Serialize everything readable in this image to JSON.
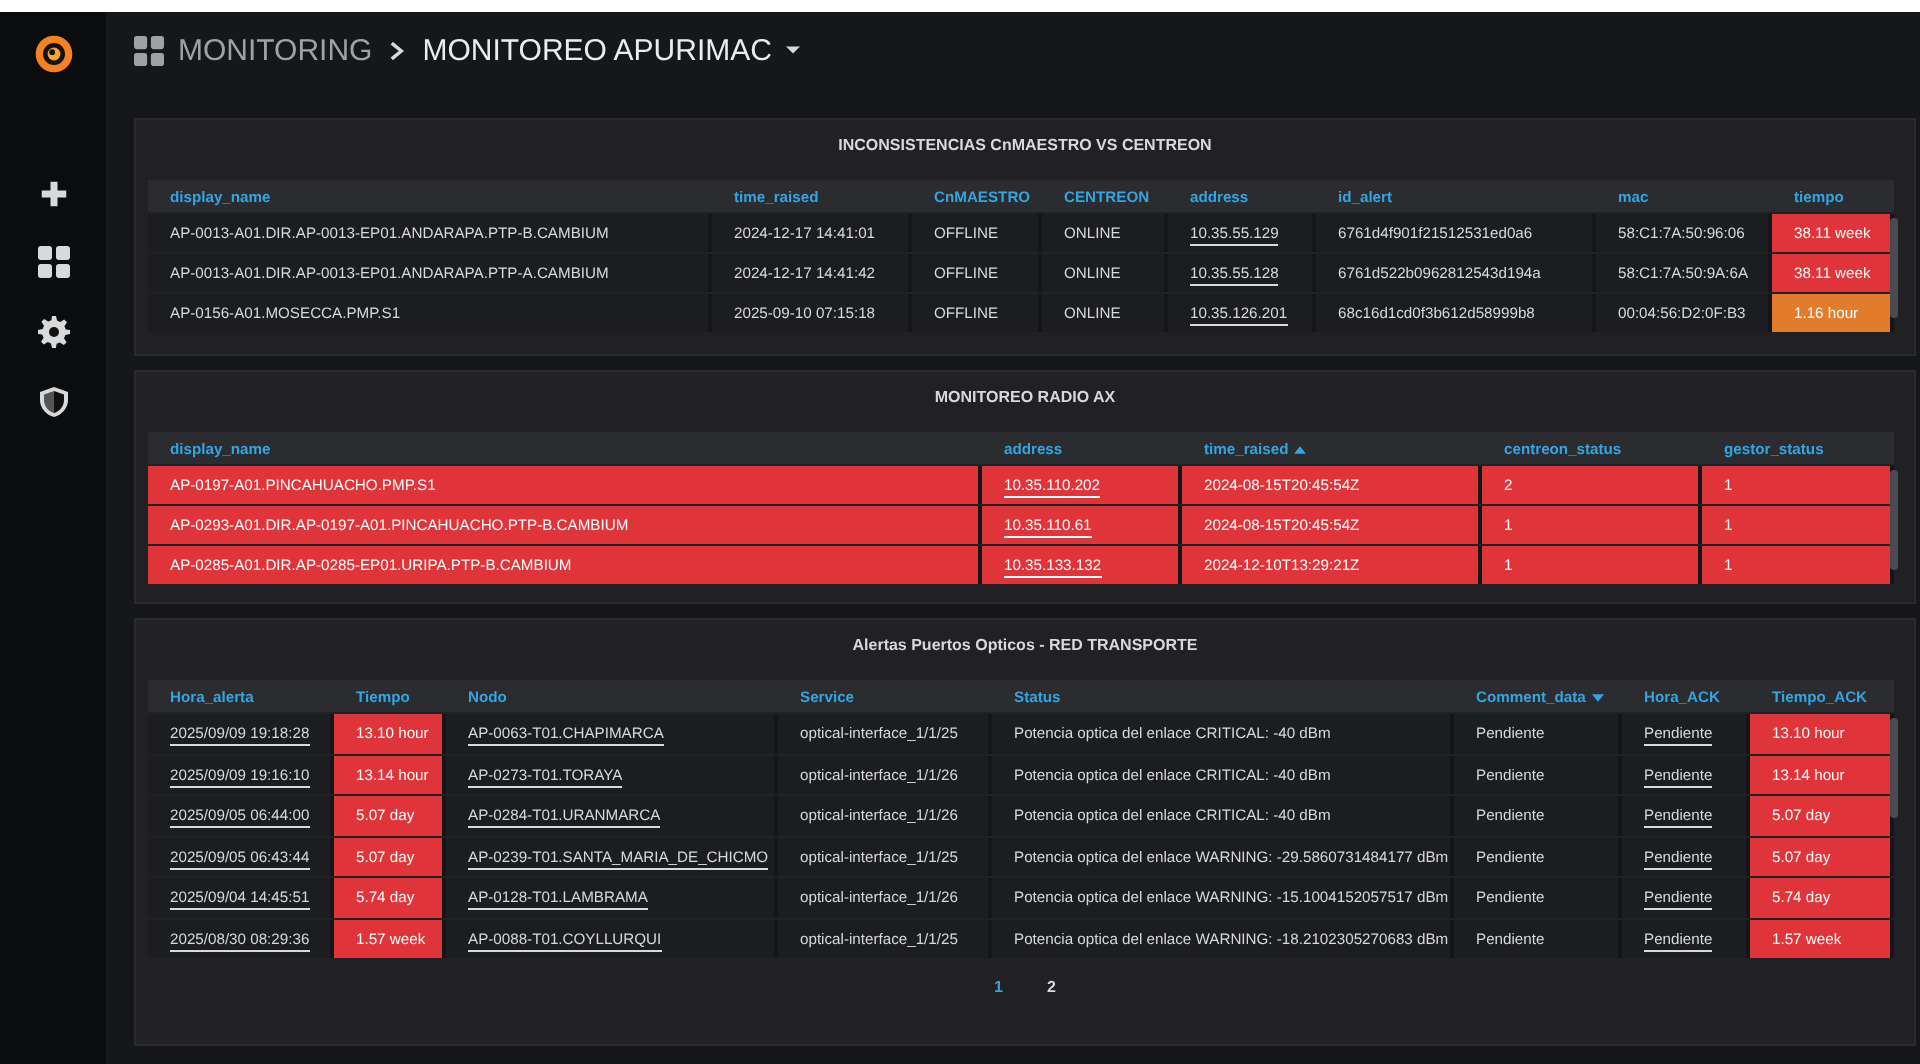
{
  "breadcrumb": {
    "folder": "MONITORING",
    "dashboard": "MONITOREO APURIMAC"
  },
  "panels": [
    {
      "title": "INCONSISTENCIAS CnMAESTRO VS CENTREON",
      "columns": [
        {
          "label": "display_name",
          "sorted": false
        },
        {
          "label": "time_raised",
          "sorted": false
        },
        {
          "label": "CnMAESTRO",
          "sorted": false
        },
        {
          "label": "CENTREON",
          "sorted": false
        },
        {
          "label": "address",
          "sorted": false
        },
        {
          "label": "id_alert",
          "sorted": false
        },
        {
          "label": "mac",
          "sorted": false
        },
        {
          "label": "tiempo",
          "sorted": false
        }
      ],
      "rows": [
        {
          "cells": [
            {
              "text": "AP-0013-A01.DIR.AP-0013-EP01.ANDARAPA.PTP-B.CAMBIUM"
            },
            {
              "text": "2024-12-17 14:41:01"
            },
            {
              "text": "OFFLINE"
            },
            {
              "text": "ONLINE"
            },
            {
              "text": "10.35.55.129",
              "link": true
            },
            {
              "text": "6761d4f901f21512531ed0a6"
            },
            {
              "text": "58:C1:7A:50:96:06"
            },
            {
              "text": "38.11 week",
              "color": "#e0343b"
            }
          ]
        },
        {
          "cells": [
            {
              "text": "AP-0013-A01.DIR.AP-0013-EP01.ANDARAPA.PTP-A.CAMBIUM"
            },
            {
              "text": "2024-12-17 14:41:42"
            },
            {
              "text": "OFFLINE"
            },
            {
              "text": "ONLINE"
            },
            {
              "text": "10.35.55.128",
              "link": true
            },
            {
              "text": "6761d522b0962812543d194a"
            },
            {
              "text": "58:C1:7A:50:9A:6A"
            },
            {
              "text": "38.11 week",
              "color": "#e0343b"
            }
          ]
        },
        {
          "cells": [
            {
              "text": "AP-0156-A01.MOSECCA.PMP.S1"
            },
            {
              "text": "2025-09-10 07:15:18"
            },
            {
              "text": "OFFLINE"
            },
            {
              "text": "ONLINE"
            },
            {
              "text": "10.35.126.201",
              "link": true
            },
            {
              "text": "68c16d1cd0f3b612d58999b8"
            },
            {
              "text": "00:04:56:D2:0F:B3"
            },
            {
              "text": "1.16 hour",
              "color": "#e07c2c"
            }
          ]
        }
      ]
    },
    {
      "title": "MONITOREO RADIO AX",
      "columns": [
        {
          "label": "display_name",
          "sorted": false
        },
        {
          "label": "address",
          "sorted": false
        },
        {
          "label": "time_raised",
          "sorted": true,
          "descending": false
        },
        {
          "label": "centreon_status",
          "sorted": false
        },
        {
          "label": "gestor_status",
          "sorted": false
        }
      ],
      "rows": [
        {
          "color": "#e0343b",
          "cells": [
            {
              "text": "AP-0197-A01.PINCAHUACHO.PMP.S1"
            },
            {
              "text": "10.35.110.202",
              "link": true
            },
            {
              "text": "2024-08-15T20:45:54Z"
            },
            {
              "text": "2"
            },
            {
              "text": "1"
            }
          ]
        },
        {
          "color": "#e0343b",
          "cells": [
            {
              "text": "AP-0293-A01.DIR.AP-0197-A01.PINCAHUACHO.PTP-B.CAMBIUM"
            },
            {
              "text": "10.35.110.61",
              "link": true
            },
            {
              "text": "2024-08-15T20:45:54Z"
            },
            {
              "text": "1"
            },
            {
              "text": "1"
            }
          ]
        },
        {
          "color": "#e0343b",
          "cells": [
            {
              "text": "AP-0285-A01.DIR.AP-0285-EP01.URIPA.PTP-B.CAMBIUM"
            },
            {
              "text": "10.35.133.132",
              "link": true
            },
            {
              "text": "2024-12-10T13:29:21Z"
            },
            {
              "text": "1"
            },
            {
              "text": "1"
            }
          ]
        }
      ]
    },
    {
      "title": "Alertas Puertos Opticos - RED TRANSPORTE",
      "columns": [
        {
          "label": "Hora_alerta",
          "sorted": false
        },
        {
          "label": "Tiempo",
          "sorted": false
        },
        {
          "label": "Nodo",
          "sorted": false
        },
        {
          "label": "Service",
          "sorted": false
        },
        {
          "label": "Status",
          "sorted": false
        },
        {
          "label": "Comment_data",
          "sorted": true,
          "descending": true
        },
        {
          "label": "Hora_ACK",
          "sorted": false
        },
        {
          "label": "Tiempo_ACK",
          "sorted": false
        }
      ],
      "rows": [
        {
          "cells": [
            {
              "text": "2025/09/09 19:18:28",
              "link": true
            },
            {
              "text": "13.10 hour",
              "color": "#e0343b"
            },
            {
              "text": "AP-0063-T01.CHAPIMARCA",
              "link": true
            },
            {
              "text": "optical-interface_1/1/25"
            },
            {
              "text": "Potencia optica del enlace CRITICAL: -40 dBm"
            },
            {
              "text": "Pendiente"
            },
            {
              "text": "Pendiente",
              "link": true
            },
            {
              "text": "13.10 hour",
              "color": "#e0343b"
            }
          ]
        },
        {
          "cells": [
            {
              "text": "2025/09/09 19:16:10",
              "link": true
            },
            {
              "text": "13.14 hour",
              "color": "#e0343b"
            },
            {
              "text": "AP-0273-T01.TORAYA",
              "link": true
            },
            {
              "text": "optical-interface_1/1/26"
            },
            {
              "text": "Potencia optica del enlace CRITICAL: -40 dBm"
            },
            {
              "text": "Pendiente"
            },
            {
              "text": "Pendiente",
              "link": true
            },
            {
              "text": "13.14 hour",
              "color": "#e0343b"
            }
          ]
        },
        {
          "cells": [
            {
              "text": "2025/09/05 06:44:00",
              "link": true
            },
            {
              "text": "5.07 day",
              "color": "#e0343b"
            },
            {
              "text": "AP-0284-T01.URANMARCA",
              "link": true
            },
            {
              "text": "optical-interface_1/1/26"
            },
            {
              "text": "Potencia optica del enlace CRITICAL: -40 dBm"
            },
            {
              "text": "Pendiente"
            },
            {
              "text": "Pendiente",
              "link": true
            },
            {
              "text": "5.07 day",
              "color": "#e0343b"
            }
          ]
        },
        {
          "cells": [
            {
              "text": "2025/09/05 06:43:44",
              "link": true
            },
            {
              "text": "5.07 day",
              "color": "#e0343b"
            },
            {
              "text": "AP-0239-T01.SANTA_MARIA_DE_CHICMO",
              "link": true
            },
            {
              "text": "optical-interface_1/1/25"
            },
            {
              "text": "Potencia optica del enlace WARNING: -29.5860731484177 dBm"
            },
            {
              "text": "Pendiente"
            },
            {
              "text": "Pendiente",
              "link": true
            },
            {
              "text": "5.07 day",
              "color": "#e0343b"
            }
          ]
        },
        {
          "cells": [
            {
              "text": "2025/09/04 14:45:51",
              "link": true
            },
            {
              "text": "5.74 day",
              "color": "#e0343b"
            },
            {
              "text": "AP-0128-T01.LAMBRAMA",
              "link": true
            },
            {
              "text": "optical-interface_1/1/26"
            },
            {
              "text": "Potencia optica del enlace WARNING: -15.1004152057517 dBm"
            },
            {
              "text": "Pendiente"
            },
            {
              "text": "Pendiente",
              "link": true
            },
            {
              "text": "5.74 day",
              "color": "#e0343b"
            }
          ]
        },
        {
          "cells": [
            {
              "text": "2025/08/30 08:29:36",
              "link": true
            },
            {
              "text": "1.57 week",
              "color": "#e0343b"
            },
            {
              "text": "AP-0088-T01.COYLLURQUI",
              "link": true
            },
            {
              "text": "optical-interface_1/1/25"
            },
            {
              "text": "Potencia optica del enlace WARNING: -18.2102305270683 dBm"
            },
            {
              "text": "Pendiente"
            },
            {
              "text": "Pendiente",
              "link": true
            },
            {
              "text": "1.57 week",
              "color": "#e0343b"
            }
          ]
        }
      ],
      "pages": [
        {
          "label": "1",
          "selected": true
        },
        {
          "label": "2",
          "selected": false
        }
      ]
    }
  ]
}
